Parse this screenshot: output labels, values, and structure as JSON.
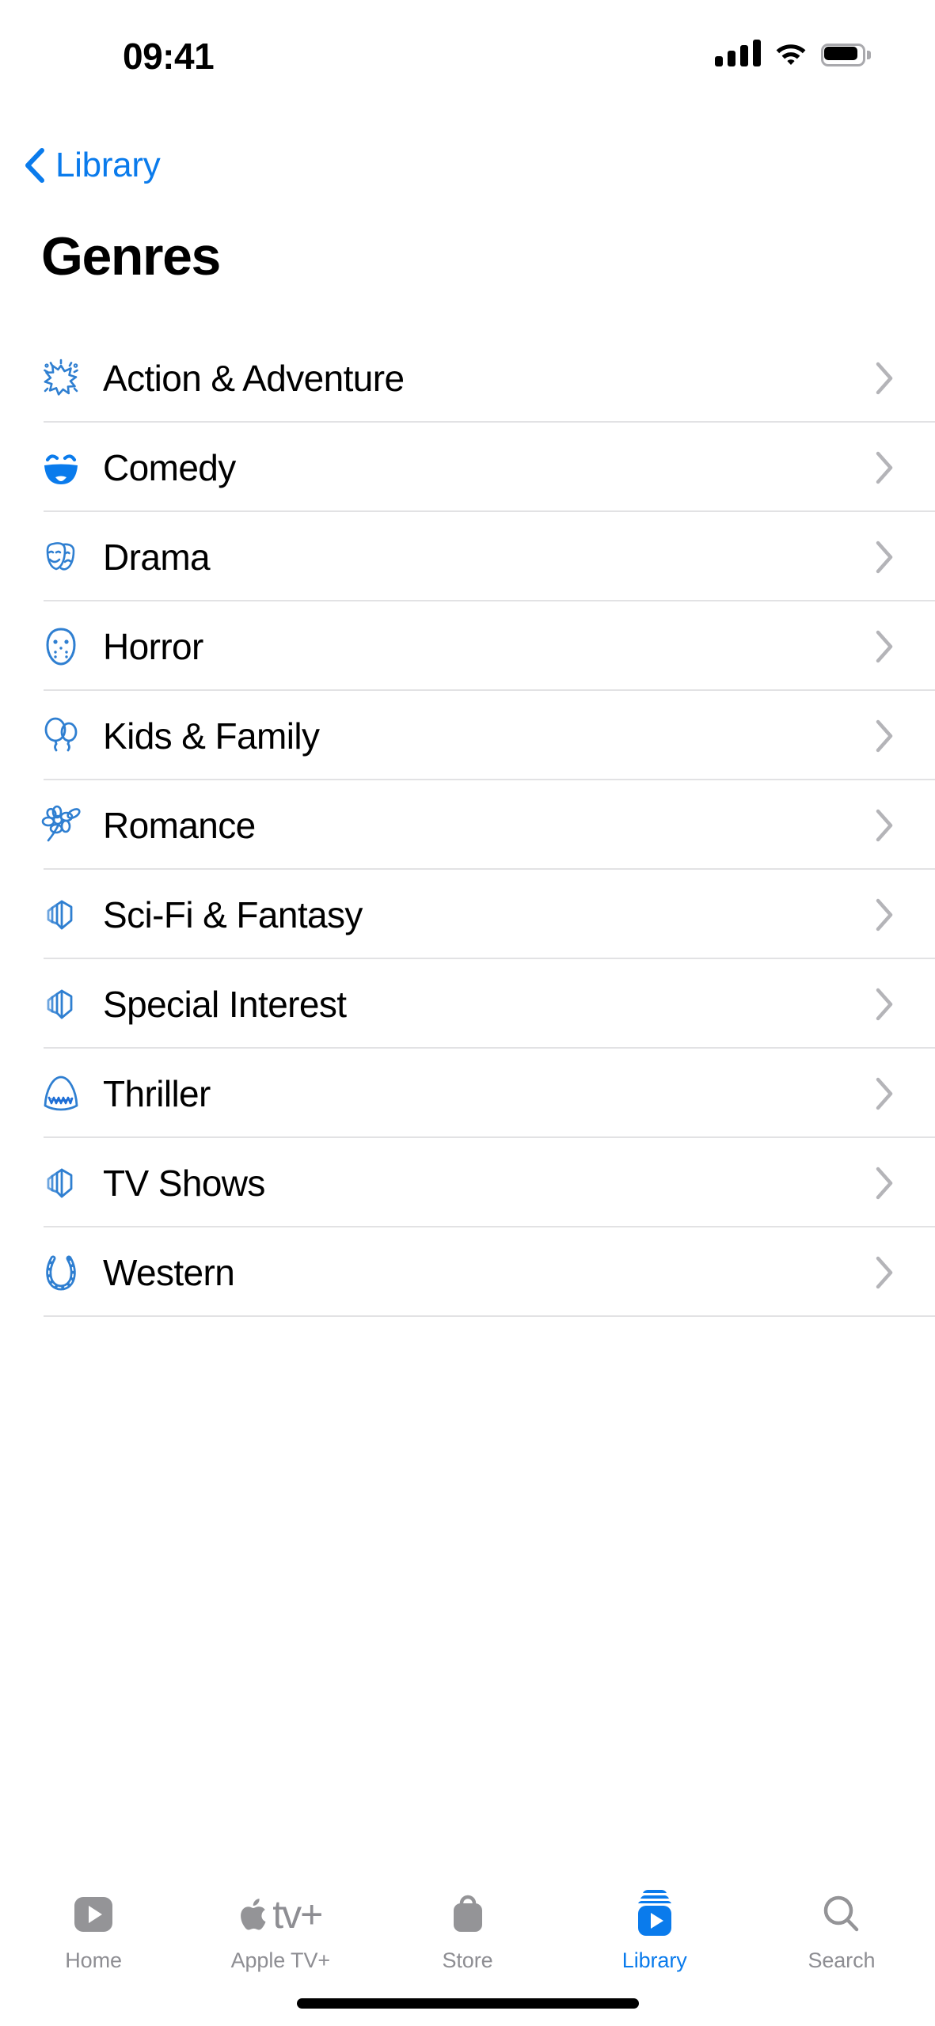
{
  "status_bar": {
    "time": "09:41",
    "cellular_icon": "cellular-signal-icon",
    "wifi_icon": "wifi-icon",
    "battery_icon": "battery-icon"
  },
  "nav": {
    "back_label": "Library",
    "back_icon": "chevron-left-icon"
  },
  "header": {
    "title": "Genres"
  },
  "accent_color": "#0a7bec",
  "icon_color": "#2f7fd1",
  "separator_color": "#e2e2e4",
  "inactive_tab_color": "#8e8e93",
  "list": {
    "rows": [
      {
        "label": "Action & Adventure",
        "icon": "explosion-icon",
        "chevron": "chevron-right-icon"
      },
      {
        "label": "Comedy",
        "icon": "smiling-face-icon",
        "chevron": "chevron-right-icon"
      },
      {
        "label": "Drama",
        "icon": "theater-masks-icon",
        "chevron": "chevron-right-icon"
      },
      {
        "label": "Horror",
        "icon": "hockey-mask-icon",
        "chevron": "chevron-right-icon"
      },
      {
        "label": "Kids & Family",
        "icon": "balloons-icon",
        "chevron": "chevron-right-icon"
      },
      {
        "label": "Romance",
        "icon": "flower-icon",
        "chevron": "chevron-right-icon"
      },
      {
        "label": "Sci-Fi & Fantasy",
        "icon": "stacked-portal-icon",
        "chevron": "chevron-right-icon"
      },
      {
        "label": "Special Interest",
        "icon": "stacked-portal-icon",
        "chevron": "chevron-right-icon"
      },
      {
        "label": "Thriller",
        "icon": "shark-icon",
        "chevron": "chevron-right-icon"
      },
      {
        "label": "TV Shows",
        "icon": "stacked-portal-icon",
        "chevron": "chevron-right-icon"
      },
      {
        "label": "Western",
        "icon": "horseshoe-icon",
        "chevron": "chevron-right-icon"
      }
    ]
  },
  "tab_bar": {
    "tabs": [
      {
        "label": "Home",
        "icon": "play-rect-icon",
        "active": false
      },
      {
        "label": "Apple TV+",
        "icon": "apple-tv-plus-icon",
        "wordmark": "tv+",
        "active": false
      },
      {
        "label": "Store",
        "icon": "shopping-bag-icon",
        "active": false
      },
      {
        "label": "Library",
        "icon": "library-stack-play-icon",
        "active": true
      },
      {
        "label": "Search",
        "icon": "magnifier-icon",
        "active": false
      }
    ]
  },
  "home_indicator": "home-indicator"
}
